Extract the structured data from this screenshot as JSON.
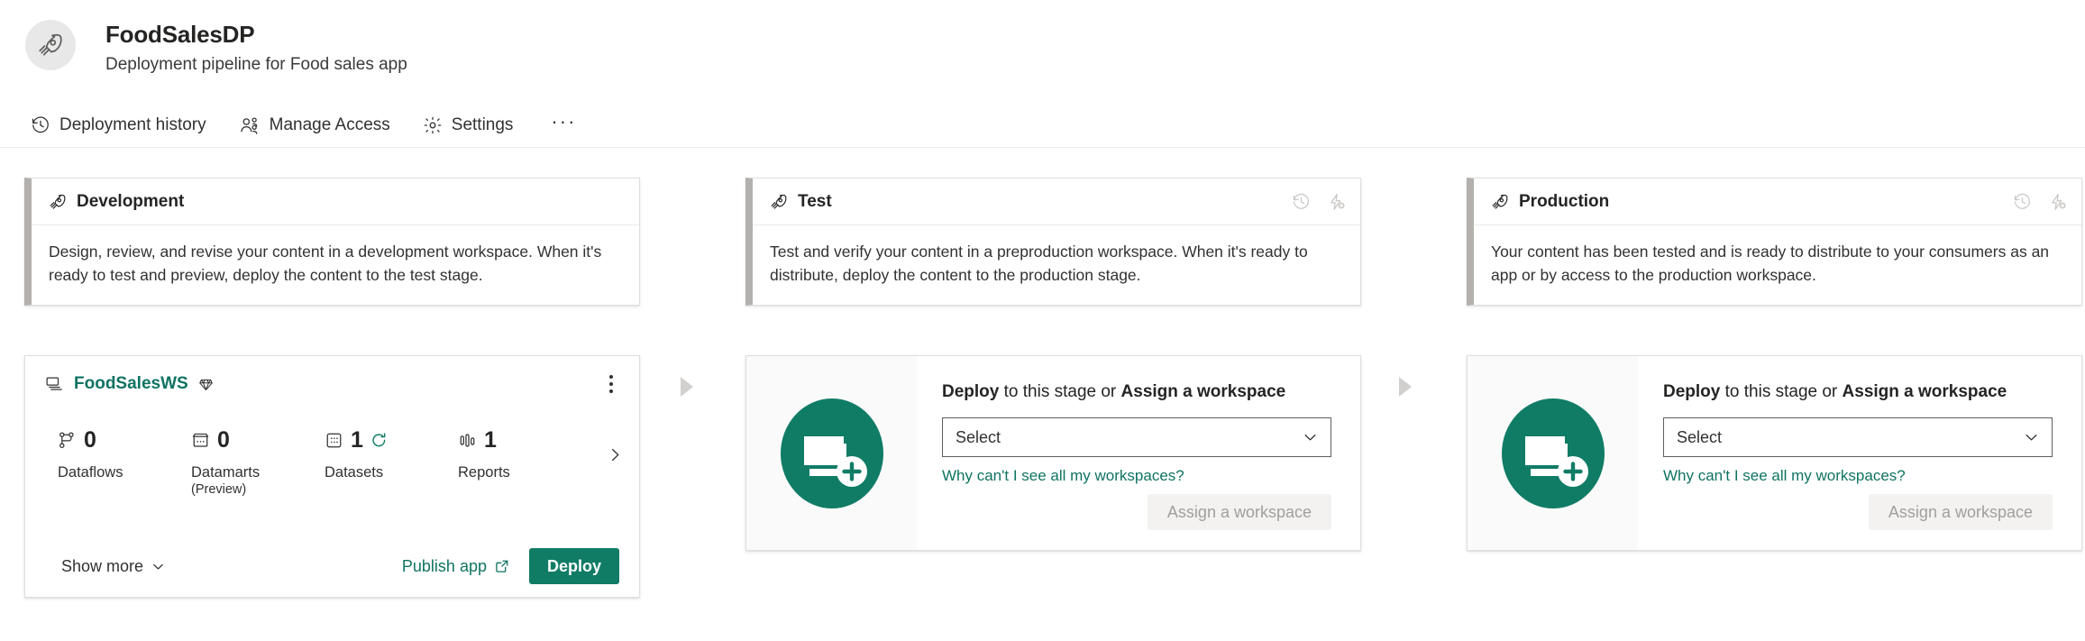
{
  "header": {
    "avatar_icon": "rocket-icon",
    "title": "FoodSalesDP",
    "subtitle": "Deployment pipeline for Food sales app",
    "toolbar": [
      {
        "label": "Deployment history",
        "icon": "history-icon"
      },
      {
        "label": "Manage Access",
        "icon": "people-icon"
      },
      {
        "label": "Settings",
        "icon": "gear-icon"
      }
    ],
    "more_label": "···"
  },
  "stages": [
    {
      "id": "development",
      "name": "Development",
      "icon": "rocket-icon",
      "description": "Design, review, and revise your content in a development workspace. When it's ready to test and preview, deploy the content to the test stage.",
      "has_head_actions": false,
      "state": "assigned"
    },
    {
      "id": "test",
      "name": "Test",
      "icon": "rocket-icon",
      "description": "Test and verify your content in a preproduction workspace. When it's ready to distribute, deploy the content to the production stage.",
      "has_head_actions": true,
      "state": "empty"
    },
    {
      "id": "production",
      "name": "Production",
      "icon": "rocket-icon",
      "description": "Your content has been tested and is ready to distribute to your consumers as an app or by access to the production workspace.",
      "has_head_actions": true,
      "state": "empty"
    }
  ],
  "stage_head_actions": [
    {
      "name": "deployment-history-icon",
      "label": "Deployment history"
    },
    {
      "name": "deployment-rules-icon",
      "label": "Deployment rules"
    }
  ],
  "workspace": {
    "icon": "workspace-stack-icon",
    "name": "FoodSalesWS",
    "premium_icon": "premium-diamond-icon",
    "kebab_icon": "more-options-icon",
    "next_icon": "chevron-right-icon",
    "metrics": [
      {
        "icon": "dataflow-icon",
        "count": "0",
        "label": "Dataflows",
        "sub": "",
        "refresh": false
      },
      {
        "icon": "datamart-icon",
        "count": "0",
        "label": "Datamarts",
        "sub": "(Preview)",
        "refresh": false
      },
      {
        "icon": "dataset-icon",
        "count": "1",
        "label": "Datasets",
        "sub": "",
        "refresh": true
      },
      {
        "icon": "report-icon",
        "count": "1",
        "label": "Reports",
        "sub": "",
        "refresh": false
      }
    ],
    "show_more_label": "Show more",
    "show_more_icon": "chevron-down-icon",
    "publish_app_label": "Publish app",
    "publish_app_icon": "external-link-icon",
    "deploy_label": "Deploy"
  },
  "empty_stage": {
    "illustration_icon": "add-workspace-icon",
    "title_prefix": "Deploy",
    "title_middle": " to this stage or ",
    "title_suffix": "Assign a workspace",
    "select_value": "Select",
    "select_chevron_icon": "chevron-down-icon",
    "why_link": "Why can't I see all my workspaces?",
    "assign_label": "Assign a workspace"
  },
  "colors": {
    "teal": "#107c66",
    "link_teal": "#0f7362",
    "accent_bar": "#b3b0ad",
    "arrow": "#d2d0ce",
    "card_border": "#e1dfdd"
  }
}
